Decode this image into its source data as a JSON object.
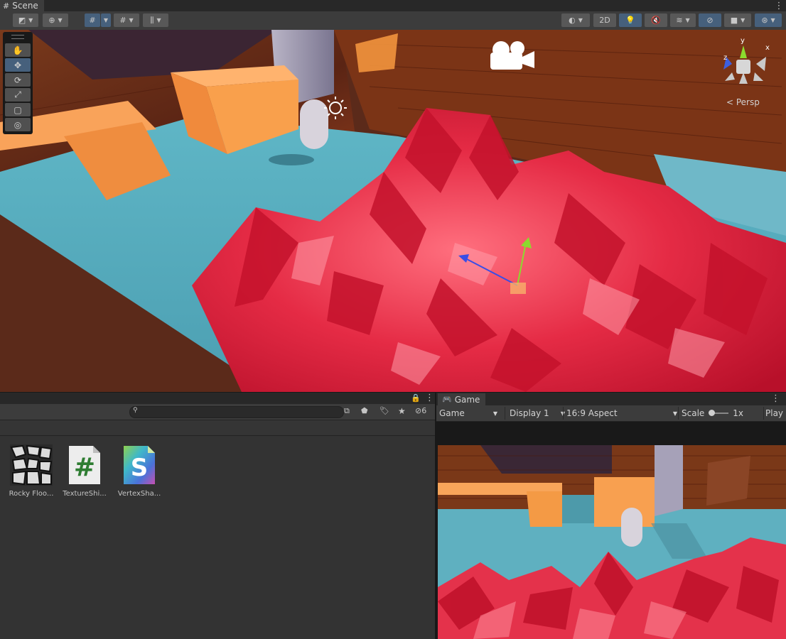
{
  "scene_panel": {
    "tab_label": "Scene",
    "toolbar": {
      "btn_2d": "2D"
    },
    "tools": [
      "hand-tool",
      "move-tool",
      "rotate-tool",
      "scale-tool",
      "rect-tool",
      "transform-tool"
    ],
    "persp_label": "< Persp",
    "gizmo_axes": {
      "y": "y",
      "x": "x",
      "z": "z"
    }
  },
  "project_panel": {
    "hidden_count": "6",
    "assets": [
      {
        "label": "Rocky Floo...",
        "icon": "texture-thumbnail"
      },
      {
        "label": "TextureShi...",
        "icon": "csharp-script-icon",
        "glyph": "#"
      },
      {
        "label": "VertexSha...",
        "icon": "shader-icon",
        "glyph": "S"
      }
    ]
  },
  "game_panel": {
    "tab_label": "Game",
    "mode": "Game",
    "display": "Display 1",
    "aspect": "16:9 Aspect",
    "scale_label": "Scale",
    "scale_value": "1x",
    "play_label": "Play"
  },
  "colors": {
    "accent": "#46607c",
    "panel_bg": "#3c3c3c",
    "lava": "#e8324a",
    "floor": "#4fa6b8",
    "blocks": "#f7a04f"
  }
}
